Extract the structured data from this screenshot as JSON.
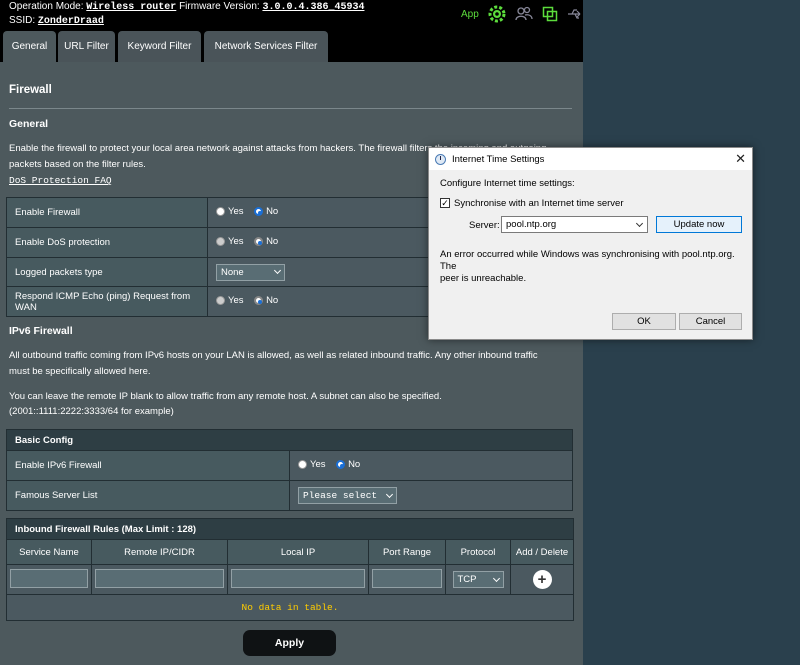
{
  "header": {
    "operation_mode_label": "Operation Mode:",
    "operation_mode_value": "Wireless router",
    "firmware_label": "Firmware Version:",
    "firmware_value": "3.0.0.4.386_45934",
    "ssid_label": "SSID:",
    "ssid_value": "ZonderDraad",
    "app_label": "App"
  },
  "tabs": [
    {
      "label": "General"
    },
    {
      "label": "URL Filter"
    },
    {
      "label": "Keyword Filter"
    },
    {
      "label": "Network Services Filter"
    }
  ],
  "firewall": {
    "title": "Firewall",
    "general_title": "General",
    "general_desc_line1": "Enable the firewall to protect your local area network against attacks from hackers. The firewall filters the incoming and outgoing",
    "general_desc_line2": "packets based on the filter rules.",
    "faq_link": "DoS Protection FAQ",
    "rows": [
      {
        "label": "Enable Firewall",
        "type": "radio",
        "yes": "Yes",
        "no": "No"
      },
      {
        "label": "Enable DoS protection",
        "type": "radio",
        "yes": "Yes",
        "no": "No"
      },
      {
        "label": "Logged packets type",
        "type": "select",
        "value": "None"
      },
      {
        "label": "Respond ICMP Echo (ping) Request from WAN",
        "type": "radio",
        "yes": "Yes",
        "no": "No"
      }
    ]
  },
  "ipv6": {
    "title": "IPv6 Firewall",
    "desc1_line1": "All outbound traffic coming from IPv6 hosts on your LAN is allowed, as well as related inbound traffic. Any other inbound traffic",
    "desc1_line2": "must be specifically allowed here.",
    "desc2_line1": "You can leave the remote IP blank to allow traffic from any remote host. A subnet can also be specified.",
    "desc2_line2": "(2001::1111:2222:3333/64 for example)",
    "basic_config_title": "Basic Config",
    "enable_label": "Enable IPv6 Firewall",
    "enable_yes": "Yes",
    "enable_no": "No",
    "famous_label": "Famous Server List",
    "famous_value": "Please select"
  },
  "inbound": {
    "title": "Inbound Firewall Rules (Max Limit : 128)",
    "columns": [
      "Service Name",
      "Remote IP/CIDR",
      "Local IP",
      "Port Range",
      "Protocol",
      "Add / Delete"
    ],
    "protocol_value": "TCP",
    "empty_text": "No data in table."
  },
  "apply_label": "Apply",
  "dialog": {
    "title": "Internet Time Settings",
    "configure_label": "Configure Internet time settings:",
    "sync_label": "Synchronise with an Internet time server",
    "server_label": "Server:",
    "server_value": "pool.ntp.org",
    "update_button": "Update now",
    "error_line1": "An error occurred while Windows was synchronising with pool.ntp.org.  The",
    "error_line2": "peer is unreachable.",
    "ok_button": "OK",
    "cancel_button": "Cancel"
  }
}
